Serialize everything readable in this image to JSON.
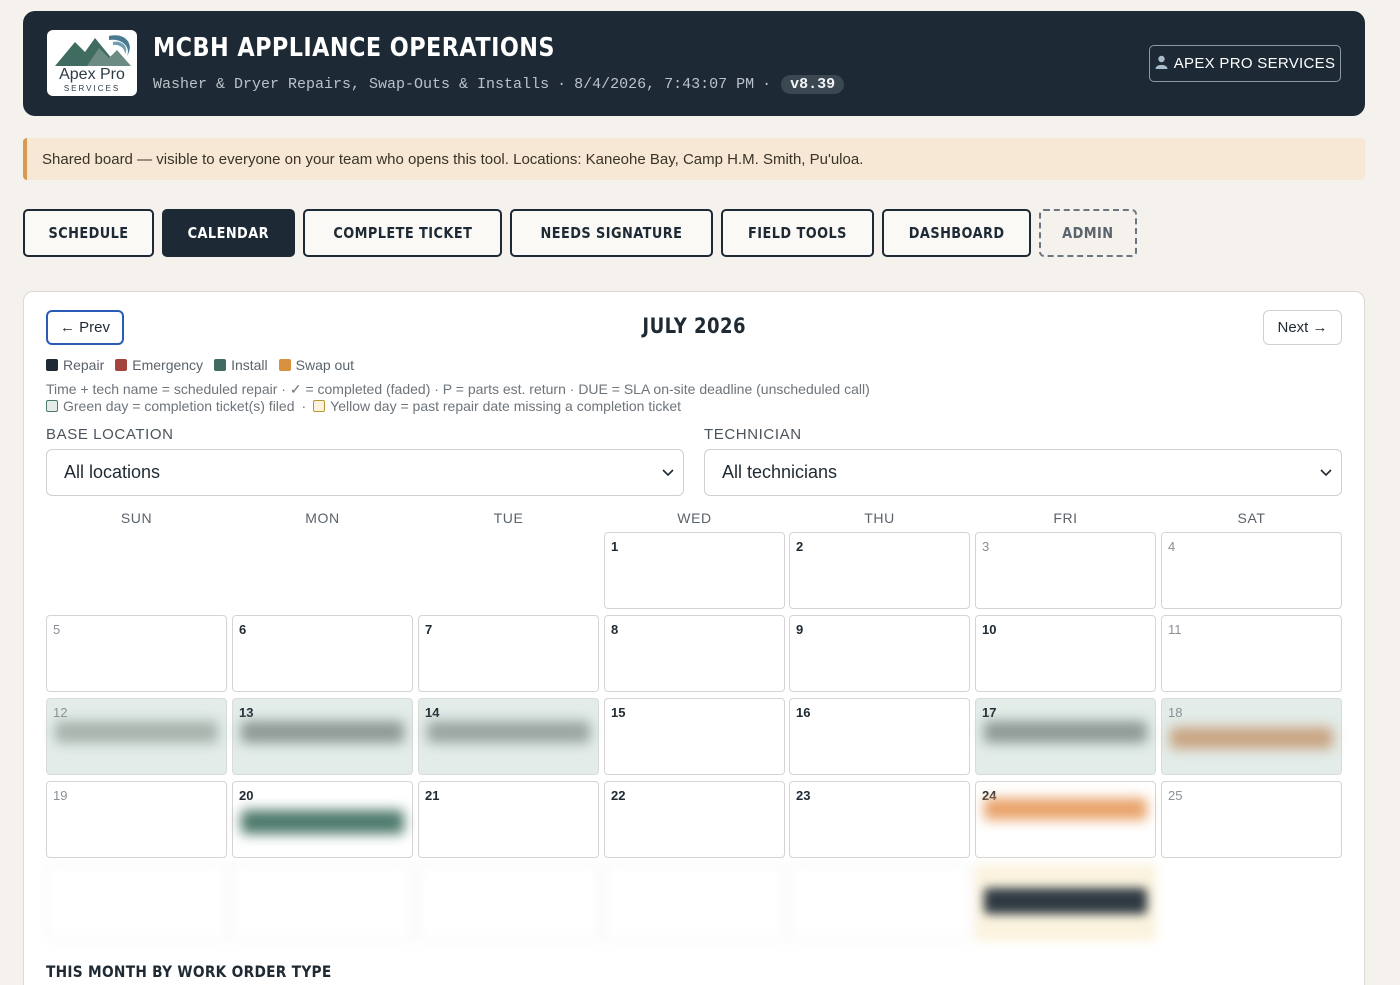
{
  "header": {
    "logo_text": "Apex Pro",
    "logo_subtext": "SERVICES",
    "title": "MCBH APPLIANCE OPERATIONS",
    "subtitle": "Washer & Dryer Repairs, Swap-Outs & Installs",
    "separator": "·",
    "timestamp": "8/4/2026, 7:43:07 PM",
    "version": "v8.39",
    "user_label": "APEX PRO SERVICES",
    "user_icon": "person-icon"
  },
  "banner": {
    "text": "Shared board — visible to everyone on your team who opens this tool. Locations: Kaneohe Bay, Camp H.M. Smith, Pu'uloa."
  },
  "nav": {
    "tabs": [
      {
        "label": "SCHEDULE",
        "active": false
      },
      {
        "label": "CALENDAR",
        "active": true
      },
      {
        "label": "COMPLETE TICKET",
        "active": false
      },
      {
        "label": "NEEDS SIGNATURE",
        "active": false
      },
      {
        "label": "FIELD TOOLS",
        "active": false
      },
      {
        "label": "DASHBOARD",
        "active": false
      },
      {
        "label": "ADMIN",
        "active": false
      }
    ]
  },
  "calendar": {
    "prev_label": "← Prev",
    "next_label": "Next →",
    "month_title": "JULY 2026",
    "legend": [
      {
        "label": "Repair",
        "color": "#1d2a35"
      },
      {
        "label": "Emergency",
        "color": "#a5443e"
      },
      {
        "label": "Install",
        "color": "#3f6b60"
      },
      {
        "label": "Swap out",
        "color": "#d8913e"
      }
    ],
    "help_line1": "Time + tech name = scheduled repair  ·  ✓ = completed (faded)  ·  P = parts est. return  ·  DUE = SLA on-site deadline (unscheduled call)",
    "help_green": "Green day = completion ticket(s) filed",
    "help_sep": "·",
    "help_yellow": "Yellow day = past repair date missing a completion ticket",
    "base_location_label": "BASE LOCATION",
    "base_location_value": "All locations",
    "technician_label": "TECHNICIAN",
    "technician_value": "All technicians",
    "weekdays": [
      "SUN",
      "MON",
      "TUE",
      "WED",
      "THU",
      "FRI",
      "SAT"
    ],
    "week1": [
      "1",
      "2",
      "3",
      "4"
    ],
    "week2": [
      "5",
      "6",
      "7",
      "8",
      "9",
      "10",
      "11"
    ],
    "week3": [
      "12",
      "13",
      "14",
      "15",
      "16",
      "17",
      "18"
    ],
    "week4": [
      "19",
      "20",
      "21",
      "22",
      "23",
      "24",
      "25"
    ],
    "colors": {
      "green_day": "#e3ece9",
      "yellow_day": "#fbf3de",
      "accent_blue": "#2a5bb5"
    }
  },
  "section": {
    "title": "THIS MONTH BY WORK ORDER TYPE"
  }
}
